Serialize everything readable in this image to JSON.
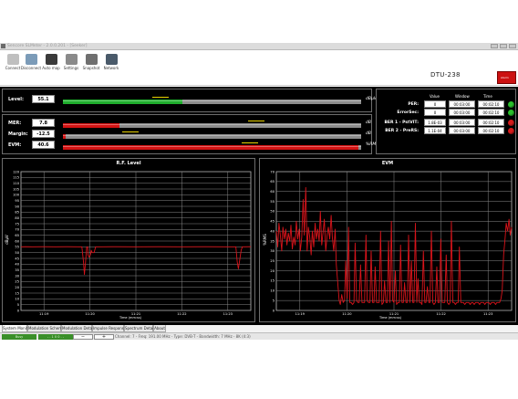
{
  "window": {
    "title": "Sencore SLMeter - 2.0.0.201 - [Seeker]"
  },
  "toolbar": {
    "buttons": [
      {
        "label": "Connect"
      },
      {
        "label": "Disconnect"
      },
      {
        "label": "Auto map"
      },
      {
        "label": "Settings"
      },
      {
        "label": "Snapshot"
      },
      {
        "label": "Network"
      }
    ],
    "device_name": "DTU-238",
    "alarm_label": "Alarm"
  },
  "meters": [
    {
      "name": "Level:",
      "value": "55.1",
      "unit": "dBμV",
      "fill_fraction": 0.4,
      "fill_color": "#1fae2d",
      "marker_fraction": 0.3
    },
    {
      "name": "MER:",
      "value": "7.8",
      "unit": "dB",
      "fill_fraction": 0.19,
      "fill_color": "#d41313",
      "marker_fraction": 0.62
    },
    {
      "name": "Margin:",
      "value": "-12.5",
      "unit": "dB",
      "fill_fraction": 0.01,
      "fill_color": "#d41313",
      "marker_fraction": 0.2
    },
    {
      "name": "EVM:",
      "value": "40.6",
      "unit": "%RMS",
      "fill_fraction": 0.99,
      "fill_color": "#d41313",
      "marker_fraction": 0.6
    }
  ],
  "error_table": {
    "headers": [
      "Value",
      "Window",
      "Time"
    ],
    "rows": [
      {
        "name": "PER:",
        "value": "0",
        "window": "00:03:00",
        "time": "00:02:10",
        "status": "ok"
      },
      {
        "name": "ErrorSec:",
        "value": "0",
        "window": "00:03:00",
        "time": "00:02:10",
        "status": "ok"
      },
      {
        "name": "BER 1 - PstVIT:",
        "value": "1.8E-03",
        "window": "00:03:00",
        "time": "00:02:10",
        "status": "error"
      },
      {
        "name": "BER 2 - PreRS:",
        "value": "1.1E-04",
        "window": "00:03:00",
        "time": "00:02:10",
        "status": "error"
      }
    ]
  },
  "colors": {
    "ok": "#2bbf2b",
    "error": "#d61a1a",
    "trace": "#d8131a",
    "grid": "#8a8a8a"
  },
  "chart_data": [
    {
      "type": "line",
      "title": "R.F. Level",
      "xlabel": "Time (mm:ss)",
      "ylabel": "dBμV",
      "ylim": [
        0,
        120
      ],
      "yticks": [
        0,
        5,
        10,
        15,
        20,
        25,
        30,
        35,
        40,
        45,
        50,
        55,
        60,
        65,
        70,
        75,
        80,
        85,
        90,
        95,
        100,
        105,
        110,
        115,
        120
      ],
      "xticks": [
        "11:19",
        "11:20",
        "11:21",
        "11:22",
        "11:23"
      ],
      "grid": true,
      "series": [
        {
          "points": [
            [
              0,
              55
            ],
            [
              0.02,
              55.1
            ],
            [
              0.05,
              55
            ],
            [
              0.1,
              55.1
            ],
            [
              0.15,
              55
            ],
            [
              0.2,
              55.1
            ],
            [
              0.25,
              55
            ],
            [
              0.265,
              55
            ],
            [
              0.272,
              42
            ],
            [
              0.276,
              31
            ],
            [
              0.281,
              42
            ],
            [
              0.286,
              55
            ],
            [
              0.29,
              55
            ],
            [
              0.292,
              48
            ],
            [
              0.297,
              46
            ],
            [
              0.302,
              48
            ],
            [
              0.306,
              52
            ],
            [
              0.31,
              50
            ],
            [
              0.318,
              50
            ],
            [
              0.325,
              55
            ],
            [
              0.35,
              55
            ],
            [
              0.4,
              55.1
            ],
            [
              0.5,
              55
            ],
            [
              0.6,
              55.1
            ],
            [
              0.7,
              55
            ],
            [
              0.8,
              55.1
            ],
            [
              0.9,
              55
            ],
            [
              0.935,
              55
            ],
            [
              0.941,
              42
            ],
            [
              0.946,
              36
            ],
            [
              0.952,
              44
            ],
            [
              0.958,
              52
            ],
            [
              0.963,
              55
            ],
            [
              1,
              55.1
            ]
          ]
        }
      ]
    },
    {
      "type": "line",
      "title": "EVM",
      "xlabel": "Time (mm:ss)",
      "ylabel": "%RMS",
      "ylim": [
        0,
        70
      ],
      "yticks": [
        0,
        5,
        10,
        15,
        20,
        25,
        30,
        35,
        40,
        45,
        50,
        55,
        60,
        65,
        70
      ],
      "xticks": [
        "11:19",
        "11:20",
        "11:21",
        "11:22",
        "11:23"
      ],
      "grid": true,
      "series": [
        {
          "points": [
            [
              0.0,
              40
            ],
            [
              0.006,
              32
            ],
            [
              0.011,
              44
            ],
            [
              0.017,
              38
            ],
            [
              0.023,
              30
            ],
            [
              0.028,
              42
            ],
            [
              0.034,
              36
            ],
            [
              0.04,
              41
            ],
            [
              0.045,
              33
            ],
            [
              0.051,
              39
            ],
            [
              0.057,
              35
            ],
            [
              0.062,
              43
            ],
            [
              0.068,
              31
            ],
            [
              0.074,
              37
            ],
            [
              0.08,
              33
            ],
            [
              0.085,
              45
            ],
            [
              0.091,
              36
            ],
            [
              0.097,
              41
            ],
            [
              0.102,
              30
            ],
            [
              0.108,
              37
            ],
            [
              0.114,
              56
            ],
            [
              0.119,
              38
            ],
            [
              0.125,
              62
            ],
            [
              0.131,
              30
            ],
            [
              0.136,
              42
            ],
            [
              0.142,
              37
            ],
            [
              0.148,
              28
            ],
            [
              0.153,
              40
            ],
            [
              0.159,
              32
            ],
            [
              0.165,
              44
            ],
            [
              0.17,
              36
            ],
            [
              0.176,
              41
            ],
            [
              0.182,
              35
            ],
            [
              0.187,
              50
            ],
            [
              0.193,
              33
            ],
            [
              0.199,
              40
            ],
            [
              0.204,
              46
            ],
            [
              0.21,
              30
            ],
            [
              0.216,
              38
            ],
            [
              0.221,
              42
            ],
            [
              0.227,
              36
            ],
            [
              0.233,
              48
            ],
            [
              0.238,
              37
            ],
            [
              0.244,
              30
            ],
            [
              0.25,
              41
            ],
            [
              0.255,
              23
            ],
            [
              0.261,
              14
            ],
            [
              0.267,
              5
            ],
            [
              0.272,
              3
            ],
            [
              0.278,
              8
            ],
            [
              0.284,
              4
            ],
            [
              0.29,
              5
            ],
            [
              0.295,
              25
            ],
            [
              0.301,
              6
            ],
            [
              0.307,
              42
            ],
            [
              0.312,
              4
            ],
            [
              0.318,
              4
            ],
            [
              0.324,
              3
            ],
            [
              0.33,
              4
            ],
            [
              0.335,
              34
            ],
            [
              0.341,
              5
            ],
            [
              0.347,
              4
            ],
            [
              0.352,
              4
            ],
            [
              0.358,
              23
            ],
            [
              0.364,
              4
            ],
            [
              0.369,
              4
            ],
            [
              0.375,
              4
            ],
            [
              0.381,
              38
            ],
            [
              0.386,
              5
            ],
            [
              0.392,
              4
            ],
            [
              0.398,
              4
            ],
            [
              0.403,
              30
            ],
            [
              0.409,
              4
            ],
            [
              0.415,
              4
            ],
            [
              0.42,
              22
            ],
            [
              0.426,
              4
            ],
            [
              0.432,
              4
            ],
            [
              0.437,
              4
            ],
            [
              0.443,
              40
            ],
            [
              0.449,
              3
            ],
            [
              0.455,
              4
            ],
            [
              0.46,
              15
            ],
            [
              0.466,
              4
            ],
            [
              0.472,
              4
            ],
            [
              0.477,
              35
            ],
            [
              0.483,
              4
            ],
            [
              0.489,
              45
            ],
            [
              0.494,
              5
            ],
            [
              0.5,
              4
            ],
            [
              0.506,
              20
            ],
            [
              0.511,
              3
            ],
            [
              0.517,
              4
            ],
            [
              0.523,
              4
            ],
            [
              0.528,
              33
            ],
            [
              0.534,
              4
            ],
            [
              0.54,
              4
            ],
            [
              0.545,
              14
            ],
            [
              0.551,
              4
            ],
            [
              0.557,
              4
            ],
            [
              0.562,
              38
            ],
            [
              0.568,
              4
            ],
            [
              0.574,
              25
            ],
            [
              0.58,
              4
            ],
            [
              0.585,
              4
            ],
            [
              0.591,
              44
            ],
            [
              0.597,
              4
            ],
            [
              0.602,
              16
            ],
            [
              0.608,
              4
            ],
            [
              0.614,
              4
            ],
            [
              0.619,
              3
            ],
            [
              0.625,
              30
            ],
            [
              0.631,
              4
            ],
            [
              0.636,
              4
            ],
            [
              0.642,
              12
            ],
            [
              0.648,
              4
            ],
            [
              0.653,
              4
            ],
            [
              0.659,
              40
            ],
            [
              0.665,
              4
            ],
            [
              0.67,
              3
            ],
            [
              0.676,
              4
            ],
            [
              0.682,
              22
            ],
            [
              0.687,
              4
            ],
            [
              0.693,
              4
            ],
            [
              0.699,
              36
            ],
            [
              0.705,
              4
            ],
            [
              0.71,
              4
            ],
            [
              0.716,
              4
            ],
            [
              0.722,
              28
            ],
            [
              0.727,
              4
            ],
            [
              0.733,
              3
            ],
            [
              0.739,
              4
            ],
            [
              0.744,
              45
            ],
            [
              0.75,
              4
            ],
            [
              0.756,
              4
            ],
            [
              0.761,
              3
            ],
            [
              0.767,
              4
            ],
            [
              0.773,
              4
            ],
            [
              0.778,
              32
            ],
            [
              0.784,
              4
            ],
            [
              0.79,
              4
            ],
            [
              0.795,
              4
            ],
            [
              0.801,
              3
            ],
            [
              0.807,
              4
            ],
            [
              0.812,
              4
            ],
            [
              0.818,
              4
            ],
            [
              0.824,
              3
            ],
            [
              0.83,
              4
            ],
            [
              0.835,
              4
            ],
            [
              0.841,
              3
            ],
            [
              0.847,
              4
            ],
            [
              0.852,
              4
            ],
            [
              0.858,
              4
            ],
            [
              0.864,
              3
            ],
            [
              0.869,
              4
            ],
            [
              0.875,
              4
            ],
            [
              0.881,
              4
            ],
            [
              0.886,
              3
            ],
            [
              0.892,
              4
            ],
            [
              0.898,
              4
            ],
            [
              0.903,
              4
            ],
            [
              0.909,
              3
            ],
            [
              0.915,
              4
            ],
            [
              0.92,
              4
            ],
            [
              0.926,
              4
            ],
            [
              0.932,
              3
            ],
            [
              0.937,
              4
            ],
            [
              0.943,
              4
            ],
            [
              0.949,
              4
            ],
            [
              0.955,
              6
            ],
            [
              0.96,
              10
            ],
            [
              0.966,
              28
            ],
            [
              0.972,
              36
            ],
            [
              0.977,
              44
            ],
            [
              0.983,
              40
            ],
            [
              0.989,
              46
            ],
            [
              0.994,
              38
            ],
            [
              1.0,
              42
            ]
          ]
        }
      ]
    }
  ],
  "tabs": [
    {
      "label": "System Monitor",
      "active": true
    },
    {
      "label": "Modulation Scheme",
      "active": false
    },
    {
      "label": "Modulation Detail",
      "active": false
    },
    {
      "label": "Impulse Response",
      "active": false
    },
    {
      "label": "Spectrum Detail",
      "active": false
    },
    {
      "label": "About",
      "active": false
    }
  ],
  "statusbar": {
    "green_a": "Busy",
    "green_b": "- . 1 0 0 . -",
    "minus": "−",
    "plus": "+",
    "text": "Channel: 7 - Freq: 191.00 MHz - Type: DVB-T - Bandwidth: 7 MHz - 8K (4:3)"
  }
}
